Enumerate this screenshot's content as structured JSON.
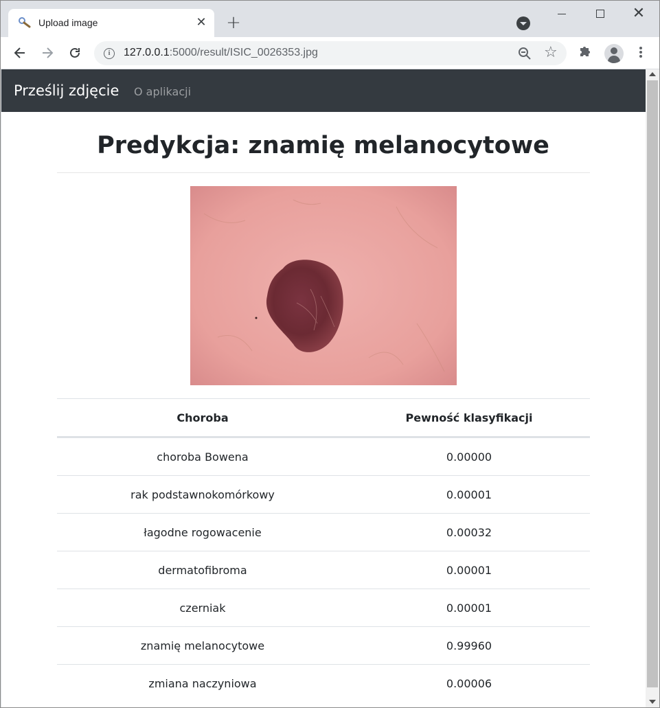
{
  "browser": {
    "tab_title": "Upload image",
    "url_host": "127.0.0.1",
    "url_rest": ":5000/result/ISIC_0026353.jpg"
  },
  "navbar": {
    "brand": "Prześlij zdjęcie",
    "about_link": "O aplikacji"
  },
  "main": {
    "heading": "Predykcja: znamię melanocytowe",
    "image_alt": "ISIC_0026353.jpg",
    "table": {
      "headers": [
        "Choroba",
        "Pewność klasyfikacji"
      ],
      "rows": [
        {
          "disease": "choroba Bowena",
          "confidence": "0.00000"
        },
        {
          "disease": "rak podstawnokomórkowy",
          "confidence": "0.00001"
        },
        {
          "disease": "łagodne rogowacenie",
          "confidence": "0.00032"
        },
        {
          "disease": "dermatofibroma",
          "confidence": "0.00001"
        },
        {
          "disease": "czerniak",
          "confidence": "0.00001"
        },
        {
          "disease": "znamię melanocytowe",
          "confidence": "0.99960"
        },
        {
          "disease": "zmiana naczyniowa",
          "confidence": "0.00006"
        }
      ]
    }
  },
  "colors": {
    "navbar_bg": "#343a40",
    "skin": "#e8a5a0",
    "lesion": "#6b2a33"
  }
}
